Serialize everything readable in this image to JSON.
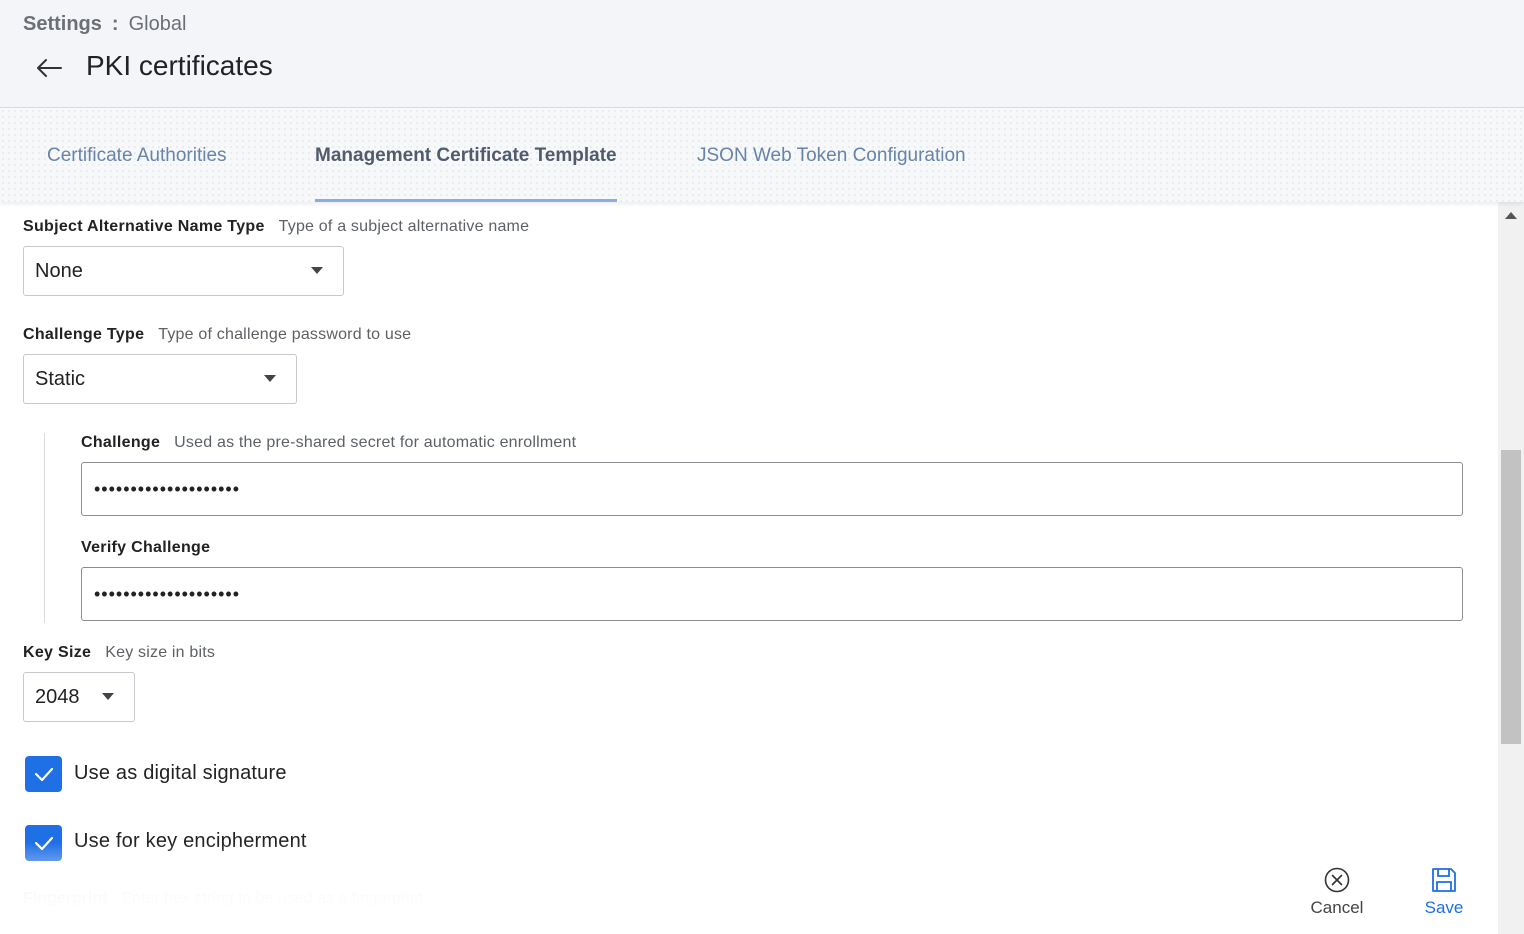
{
  "breadcrumb": {
    "root": "Settings",
    "separator": ":",
    "current": "Global"
  },
  "page": {
    "title": "PKI certificates",
    "back_icon": "arrow-left-icon"
  },
  "tabs": [
    {
      "label": "Certificate Authorities",
      "active": false
    },
    {
      "label": "Management Certificate Template",
      "active": true
    },
    {
      "label": "JSON Web Token Configuration",
      "active": false
    }
  ],
  "form": {
    "san_type": {
      "label": "Subject Alternative Name Type",
      "description": "Type of a subject alternative name",
      "value": "None"
    },
    "challenge_type": {
      "label": "Challenge Type",
      "description": "Type of challenge password to use",
      "value": "Static"
    },
    "challenge": {
      "label": "Challenge",
      "description": "Used as the pre-shared secret for automatic enrollment",
      "value": "••••••••••••••••••••"
    },
    "verify_challenge": {
      "label": "Verify Challenge",
      "value": "••••••••••••••••••••"
    },
    "key_size": {
      "label": "Key Size",
      "description": "Key size in bits",
      "value": "2048"
    },
    "digital_signature": {
      "label": "Use as digital signature",
      "checked": true
    },
    "key_encipherment": {
      "label": "Use for key encipherment",
      "checked": true
    },
    "fingerprint": {
      "label": "Fingerprint",
      "description": "Enter hex string to be used as a fingerprint"
    }
  },
  "actions": {
    "cancel_label": "Cancel",
    "save_label": "Save"
  },
  "colors": {
    "accent": "#1f6fe5",
    "tab_active_underline": "#8aaee0",
    "header_bg": "#f3f5f9"
  }
}
